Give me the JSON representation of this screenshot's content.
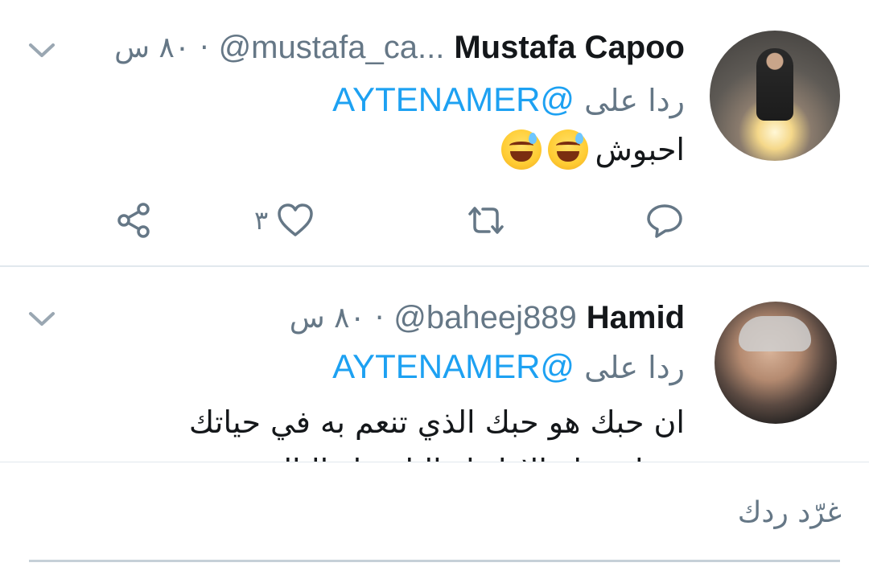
{
  "tweets": [
    {
      "name": "Mustafa Capoo",
      "handle": "@mustafa_ca...",
      "separator": "·",
      "time": "٨٠ س",
      "reply_prefix": "ردا على",
      "reply_to": "@AYTENAMER",
      "text": "احبوش",
      "emojis": [
        "grinning-sweat-emoji",
        "grinning-sweat-emoji"
      ],
      "like_count": "٣"
    },
    {
      "name": "Hamid",
      "handle": "@baheej889",
      "separator": "·",
      "time": "٨٠ س",
      "reply_prefix": "ردا على",
      "reply_to": "@AYTENAMER",
      "text_lines": [
        "ان حبك هو حبك الذي تنعم به في حياتك",
        "سواء حبك الاول او الثاني او الثالث"
      ]
    }
  ],
  "composer": {
    "placeholder": "غرّد ردك"
  },
  "colors": {
    "accent": "#1da1f2",
    "secondary_text": "#657786",
    "divider": "#e1e8ed"
  }
}
